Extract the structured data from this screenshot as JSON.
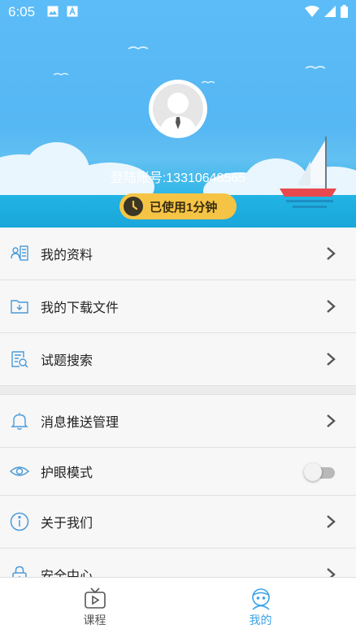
{
  "status_bar": {
    "time": "6:05"
  },
  "profile": {
    "account_label": "登陆账号:13310648565",
    "usage_label": "已使用1分钟"
  },
  "menu": {
    "items": [
      {
        "label": "我的资料",
        "icon": "profile-card-icon"
      },
      {
        "label": "我的下载文件",
        "icon": "download-folder-icon"
      },
      {
        "label": "试题搜索",
        "icon": "search-document-icon"
      },
      {
        "label": "消息推送管理",
        "icon": "bell-icon"
      },
      {
        "label": "护眼模式",
        "icon": "eye-icon",
        "toggle": false
      },
      {
        "label": "关于我们",
        "icon": "info-icon"
      },
      {
        "label": "安全中心",
        "icon": "lock-icon"
      }
    ]
  },
  "tabbar": {
    "tabs": [
      {
        "label": "课程",
        "icon": "tv-play-icon",
        "active": false
      },
      {
        "label": "我的",
        "icon": "user-face-icon",
        "active": true
      }
    ]
  },
  "colors": {
    "accent": "#3aa3e8",
    "usage_badge": "#f6c445",
    "icon_stroke": "#4a9ad8"
  }
}
